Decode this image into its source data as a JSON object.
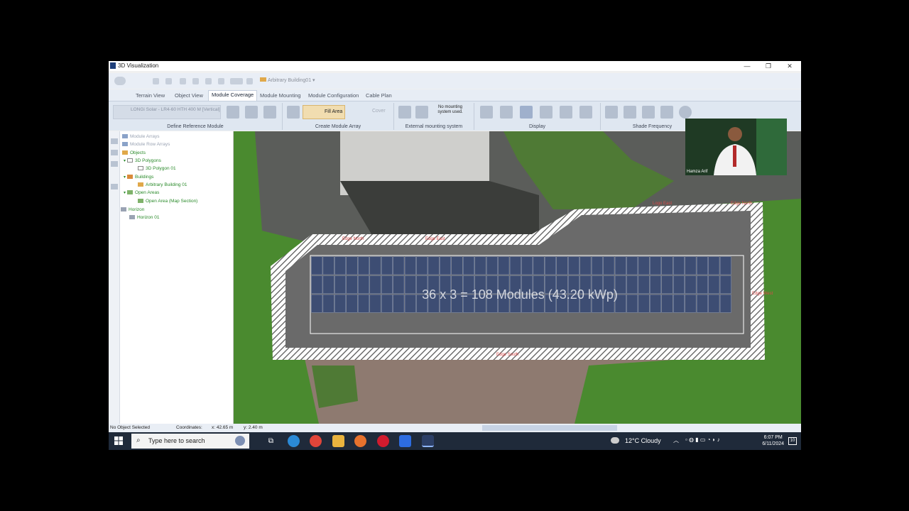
{
  "window": {
    "title": "3D Visualization",
    "minimize": "—",
    "maximize": "❐",
    "close": "✕"
  },
  "quick_access": {
    "building_select": "Arbitrary Building01"
  },
  "ribbon": {
    "tabs": [
      {
        "label": "Terrain View"
      },
      {
        "label": "Object View"
      },
      {
        "label": "Module Coverage",
        "active": true
      },
      {
        "label": "Module Mounting"
      },
      {
        "label": "Module Configuration"
      },
      {
        "label": "Cable Plan"
      }
    ],
    "groups": {
      "define_reference_module": {
        "label": "Define Reference Module",
        "selected_module": "LONGi Solar - LR4-60 HTH 400 M [Vertical]"
      },
      "create_module_array": {
        "label": "Create Module Array",
        "fill_area": "Fill Area",
        "cover": "Cover"
      },
      "external_mounting": {
        "label": "External mounting system",
        "note": "No mounting system used."
      },
      "display": {
        "label": "Display"
      },
      "shade_frequency": {
        "label": "Shade Frequency"
      }
    }
  },
  "object_tree": {
    "items": [
      {
        "label": "Module Arrays"
      },
      {
        "label": "Module Row Arrays"
      },
      {
        "label": "Objects"
      },
      {
        "label": "3D Polygons"
      },
      {
        "label": "3D Polygon 01"
      },
      {
        "label": "Buildings"
      },
      {
        "label": "Arbitrary Building 01"
      },
      {
        "label": "Open Areas"
      },
      {
        "label": "Open Area (Map Section)"
      },
      {
        "label": "Horizon"
      },
      {
        "label": "Horizon 01"
      }
    ]
  },
  "viewport": {
    "array_summary": "36 x 3 = 108 Modules (43.20 kWp)",
    "edge_labels": [
      "Edge North",
      "Edge East",
      "Edge South",
      "Edge West",
      "Logo East",
      "Edge North"
    ],
    "module_columns": 36,
    "module_rows": 3
  },
  "status_bar": {
    "selection": "No Object Selected",
    "coordinates_label": "Coordinates:",
    "x": "x: 42.65 m",
    "y": "y: 2.40 m"
  },
  "taskbar": {
    "search_placeholder": "Type here to search",
    "weather": "12°C  Cloudy",
    "time": "6:07 PM",
    "date": "6/11/2024",
    "notifications": "10"
  },
  "webcam": {
    "name": "Hamza Arif"
  },
  "colors": {
    "ribbon_bg": "#dfe7f1",
    "tree_text_green": "#2a8a2a",
    "fill_area_active": "#f1ddb0",
    "roof_gray": "#6a6a6a",
    "grass": "#4a8a2f"
  }
}
